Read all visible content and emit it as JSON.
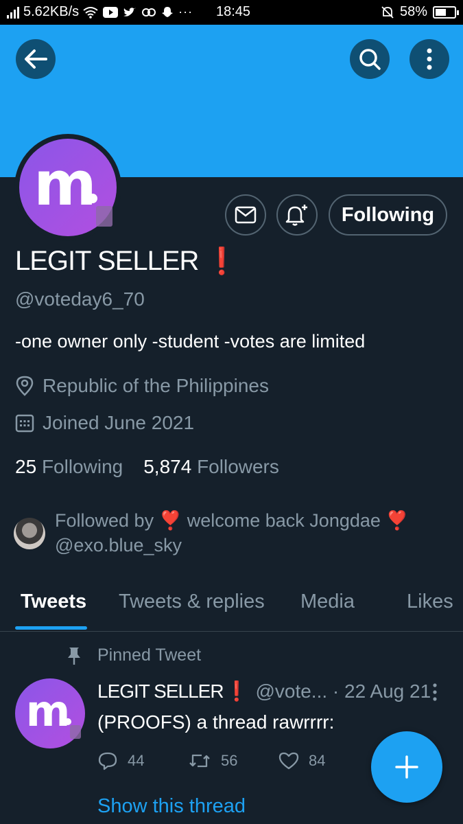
{
  "status_bar": {
    "network_speed": "5.62KB/s",
    "notification_icons": "▶ ♥ ∞ ▲ ···",
    "time": "18:45",
    "battery_percent": "58%",
    "battery_level": 0.58
  },
  "header": {
    "back_icon": "arrow-left-icon",
    "search_icon": "search-icon",
    "more_icon": "more-vertical-icon",
    "banner_color": "#1da1f2"
  },
  "profile": {
    "avatar_letter": "m",
    "following_button_label": "Following",
    "display_name": "LEGIT SELLER",
    "name_emoji": "❗",
    "handle": "@voteday6_70",
    "bio": "-one owner only -student -votes are limited",
    "location": "Republic of the Philippines",
    "joined": "Joined June 2021",
    "following_count": "25",
    "following_label": "Following",
    "followers_count": "5,874",
    "followers_label": "Followers",
    "followed_by_line1_prefix": "Followed by",
    "followed_by_heart": "❣️",
    "followed_by_name": "welcome back Jongdae",
    "followed_by_line2": "@exo.blue_sky"
  },
  "tabs": [
    {
      "label": "Tweets",
      "active": true
    },
    {
      "label": "Tweets & replies",
      "active": false
    },
    {
      "label": "Media",
      "active": false
    },
    {
      "label": "Likes",
      "active": false
    }
  ],
  "pinned_tweet": {
    "pinned_label": "Pinned Tweet",
    "avatar_letter": "m",
    "name": "LEGIT SELLER",
    "name_emoji": "❗",
    "handle_and_date": "@vote... · 22 Aug 21",
    "text": "(PROOFS) a thread rawrrrr:",
    "replies": "44",
    "retweets": "56",
    "likes": "84",
    "show_thread": "Show this thread"
  },
  "colors": {
    "accent": "#1da1f2",
    "background": "#15202b",
    "muted_text": "#8899a6",
    "emoji_red": "#e0245e"
  }
}
